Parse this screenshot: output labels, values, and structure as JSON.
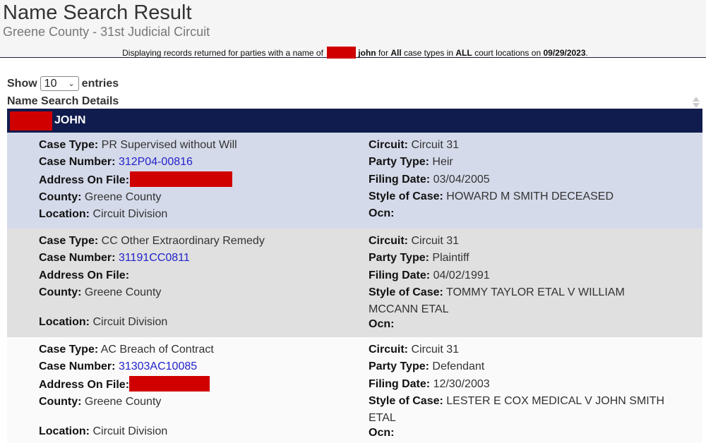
{
  "header": {
    "title": "Name Search Result",
    "subtitle": "Greene County - 31st Judicial Circuit",
    "display_line": {
      "prefix": "Displaying records returned for parties with a name of",
      "name_visible": "john",
      "mid1": "for",
      "case_types": "All",
      "mid2": "case types in",
      "locations": "ALL",
      "mid3": "court locations on",
      "date": "09/29/2023",
      "suffix": "."
    }
  },
  "controls": {
    "show_label": "Show",
    "entries_value": "10",
    "entries_label": "entries"
  },
  "table": {
    "header": "Name Search Details",
    "party_name_visible": "JOHN"
  },
  "labels": {
    "case_type": "Case Type:",
    "case_number": "Case Number:",
    "address": "Address On File:",
    "county": "County:",
    "location": "Location:",
    "circuit": "Circuit:",
    "party_type": "Party Type:",
    "filing_date": "Filing Date:",
    "style": "Style of Case:",
    "ocn": "Ocn:"
  },
  "records": [
    {
      "case_type": "PR Supervised without Will",
      "case_number": "312P04-00816",
      "address_redacted": true,
      "county": "Greene County",
      "location": "Circuit Division",
      "circuit": "Circuit 31",
      "party_type": "Heir",
      "filing_date": "03/04/2005",
      "style_line1": "HOWARD M SMITH DECEASED",
      "style_line2": "",
      "ocn": ""
    },
    {
      "case_type": "CC Other Extraordinary Remedy",
      "case_number": "31191CC0811",
      "address_redacted": false,
      "county": "Greene County",
      "location": "Circuit Division",
      "circuit": "Circuit 31",
      "party_type": "Plaintiff",
      "filing_date": "04/02/1991",
      "style_line1": "TOMMY TAYLOR ETAL V WILLIAM",
      "style_line2": "MCCANN ETAL",
      "ocn": ""
    },
    {
      "case_type": "AC Breach of Contract",
      "case_number": "31303AC10085",
      "address_redacted": true,
      "county": "Greene County",
      "location": "Circuit Division",
      "circuit": "Circuit 31",
      "party_type": "Defendant",
      "filing_date": "12/30/2003",
      "style_line1": "LESTER E COX MEDICAL V JOHN SMITH",
      "style_line2": "ETAL",
      "ocn": ""
    }
  ],
  "colors": {
    "name_bar": "#0f1c4d",
    "redaction": "#d00000",
    "link": "#2222cc",
    "row_highlight": "#d5daea",
    "row_alt": "#e0e0e0",
    "row_plain": "#fafafa"
  }
}
